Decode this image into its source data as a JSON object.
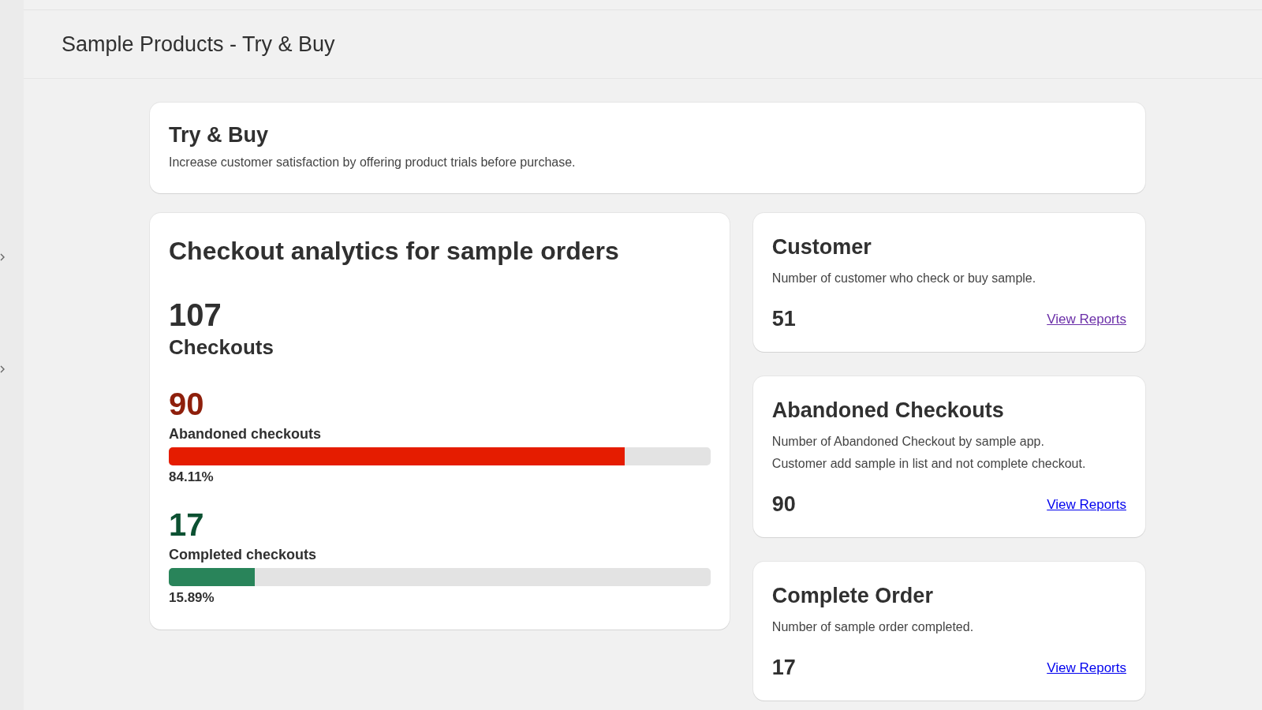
{
  "page": {
    "title": "Sample Products - Try & Buy"
  },
  "intro": {
    "title": "Try & Buy",
    "description": "Increase customer satisfaction by offering product trials before purchase."
  },
  "analytics": {
    "title": "Checkout analytics for sample orders",
    "total": "107",
    "total_label": "Checkouts",
    "metrics": [
      {
        "kind": "abandoned",
        "value": "90",
        "label": "Abandoned checkouts",
        "level": 0.8411,
        "percent": "84.11%"
      },
      {
        "kind": "completed",
        "value": "17",
        "label": "Completed checkouts",
        "level": 0.1589,
        "percent": "15.89%"
      }
    ]
  },
  "stat_cards": [
    {
      "title": "Customer",
      "description": [
        "Number of customer who check or buy sample."
      ],
      "value": "51",
      "link": "View Reports",
      "visited": true
    },
    {
      "title": "Abandoned Checkouts",
      "description": [
        "Number of Abandoned Checkout by sample app.",
        "Customer add sample in list and not complete checkout."
      ],
      "value": "90",
      "link": "View Reports",
      "visited": false
    },
    {
      "title": "Complete Order",
      "description": [
        "Number of sample order completed."
      ],
      "value": "17",
      "link": "View Reports",
      "visited": false
    }
  ]
}
